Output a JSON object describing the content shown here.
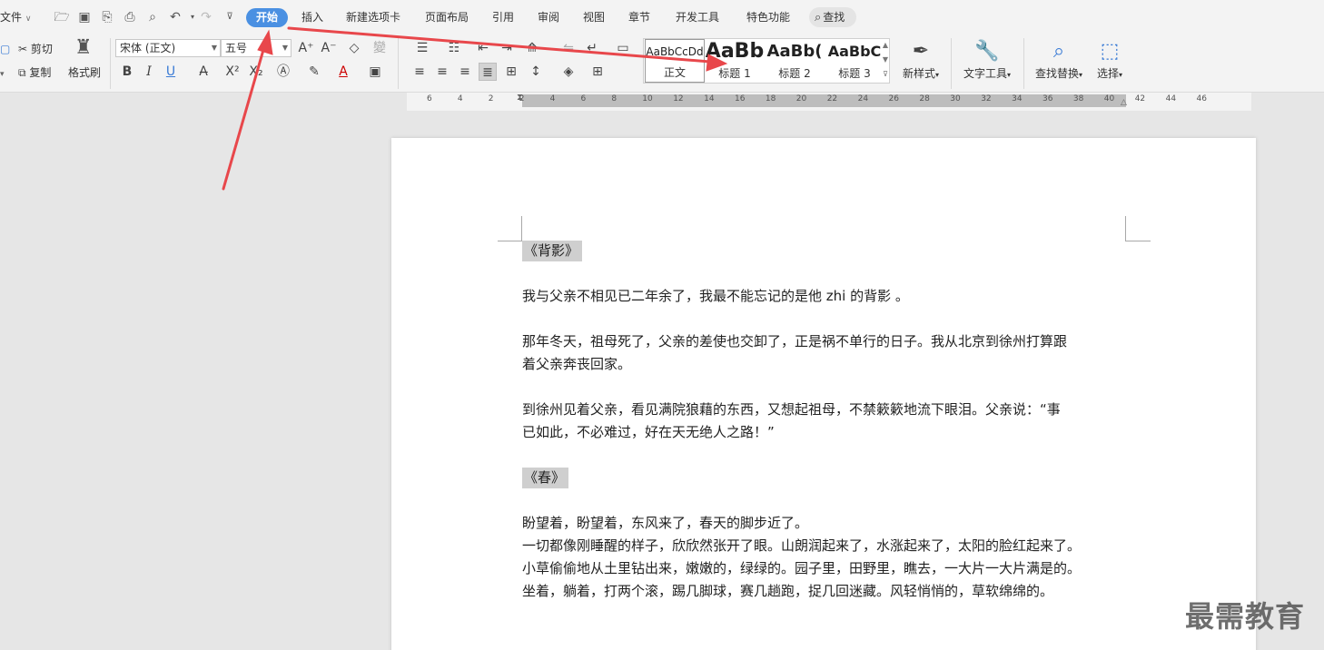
{
  "menu": {
    "file": "文件",
    "start": "开始",
    "tabs": [
      "插入",
      "新建选项卡",
      "页面布局",
      "引用",
      "审阅",
      "视图",
      "章节",
      "开发工具",
      "特色功能"
    ],
    "search": "查找"
  },
  "ribbon": {
    "cut": "剪切",
    "copy": "复制",
    "format_painter": "格式刷",
    "font_name": "宋体 (正文)",
    "font_size": "五号",
    "styles": [
      {
        "preview": "AaBbCcDd",
        "label": "正文"
      },
      {
        "preview": "AaBb",
        "label": "标题 1"
      },
      {
        "preview": "AaBb(",
        "label": "标题 2"
      },
      {
        "preview": "AaBbC",
        "label": "标题 3"
      }
    ],
    "new_style": "新样式",
    "text_tools": "文字工具",
    "find_replace": "查找替换",
    "select": "选择"
  },
  "ruler": {
    "labels": [
      "6",
      "4",
      "2",
      "2",
      "4",
      "6",
      "8",
      "10",
      "12",
      "14",
      "16",
      "18",
      "20",
      "22",
      "24",
      "26",
      "28",
      "30",
      "32",
      "34",
      "36",
      "38",
      "40",
      "42",
      "44",
      "46"
    ]
  },
  "document": {
    "heading1": "《背影》",
    "p1": "我与父亲不相见已二年余了，我最不能忘记的是他 zhi 的背影 。",
    "p2_l1": "那年冬天，祖母死了，父亲的差使也交卸了，正是祸不单行的日子。我从北京到徐州打算跟",
    "p2_l2": "着父亲奔丧回家。",
    "p3_l1": "到徐州见着父亲，看见满院狼藉的东西，又想起祖母，不禁簌簌地流下眼泪。父亲说：“事",
    "p3_l2": "已如此，不必难过，好在天无绝人之路！”",
    "heading2": "《春》",
    "p4_l1": "盼望着，盼望着，东风来了，春天的脚步近了。",
    "p4_l2": "一切都像刚睡醒的样子，欣欣然张开了眼。山朗润起来了，水涨起来了，太阳的脸红起来了。",
    "p4_l3": "小草偷偷地从土里钻出来，嫩嫩的，绿绿的。园子里，田野里，瞧去，一大片一大片满是的。",
    "p4_l4": "坐着，躺着，打两个滚，踢几脚球，赛几趟跑，捉几回迷藏。风轻悄悄的，草软绵绵的。"
  },
  "watermark": "最需教育",
  "colors": {
    "accent": "#4a90e2",
    "arrow": "#e8474b",
    "highlight": "#cfcfcf"
  }
}
